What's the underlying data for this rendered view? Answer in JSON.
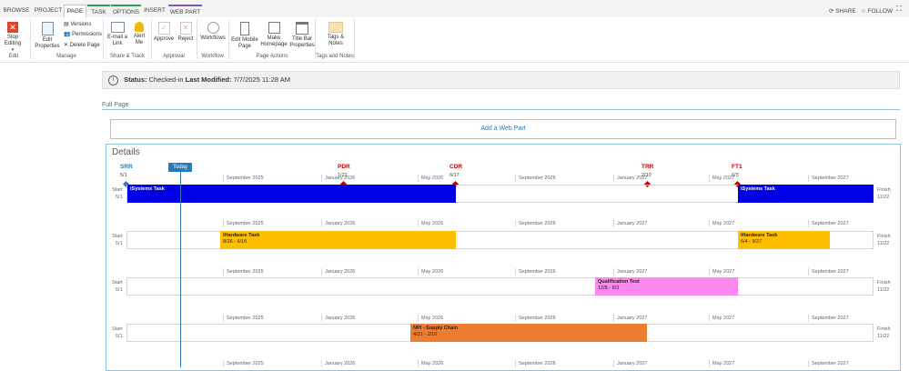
{
  "ribbon": {
    "tabs": [
      "BROWSE",
      "PROJECT",
      "PAGE",
      "TASK",
      "OPTIONS",
      "INSERT",
      "WEB PART"
    ],
    "share": "SHARE",
    "follow": "FOLLOW",
    "buttons": {
      "stop_editing": "Stop Editing",
      "edit_properties": "Edit Properties",
      "versions": "Versions",
      "permissions": "Permissions",
      "delete_page": "Delete Page",
      "email_link": "E-mail a Link",
      "alert_me": "Alert Me",
      "approve": "Approve",
      "reject": "Reject",
      "workflows": "Workflows",
      "edit_mobile_page": "Edit Mobile Page",
      "make_homepage": "Make Homepage",
      "title_bar_properties": "Title Bar Properties",
      "tags_notes": "Tags & Notes"
    },
    "groups": [
      "Edit",
      "Manage",
      "Share & Track",
      "Approval",
      "Workflow",
      "Page Actions",
      "Tags and Notes"
    ]
  },
  "status": {
    "label": "Status:",
    "value": "Checked-in",
    "modified_label": "Last Modified:",
    "modified_value": "7/7/2025 11:28 AM"
  },
  "page": {
    "zone_title": "Full Page",
    "add_web_part": "Add a Web Part",
    "webpart_title": "Details"
  },
  "timeline": {
    "today": "Today",
    "months": [
      "September 2025",
      "January 2026",
      "May 2026",
      "September 2026",
      "January 2027",
      "May 2027",
      "September 2027"
    ],
    "start_label": "Start",
    "start_date": "5/1",
    "finish_label": "Finish",
    "finish_date": "11/22",
    "milestones": [
      {
        "name": "SRR",
        "date": "5/1"
      },
      {
        "name": "PDR",
        "date": "1/22"
      },
      {
        "name": "CDR",
        "date": "6/17"
      },
      {
        "name": "TRR",
        "date": "2/10"
      },
      {
        "name": "FT1",
        "date": "6/3"
      }
    ],
    "rows": [
      {
        "bars": [
          {
            "name": "iSystems Task",
            "dates": "",
            "color": "#0000e6"
          },
          {
            "name": "iSystems Task",
            "dates": "",
            "color": "#0000e6"
          }
        ]
      },
      {
        "bars": [
          {
            "name": "iHardware Task",
            "dates": "8/26 - 6/16",
            "color": "#ffbf00"
          },
          {
            "name": "iHardware Task",
            "dates": "6/4 - 9/27",
            "color": "#ffbf00"
          }
        ]
      },
      {
        "bars": [
          {
            "name": "Qualification Test",
            "dates": "12/8 - 6/3",
            "color": "#ff88f0"
          }
        ]
      },
      {
        "bars": [
          {
            "name": "NPI - Supply Chain",
            "dates": "4/21 - 2/10",
            "color": "#ed7d31"
          }
        ]
      }
    ]
  }
}
